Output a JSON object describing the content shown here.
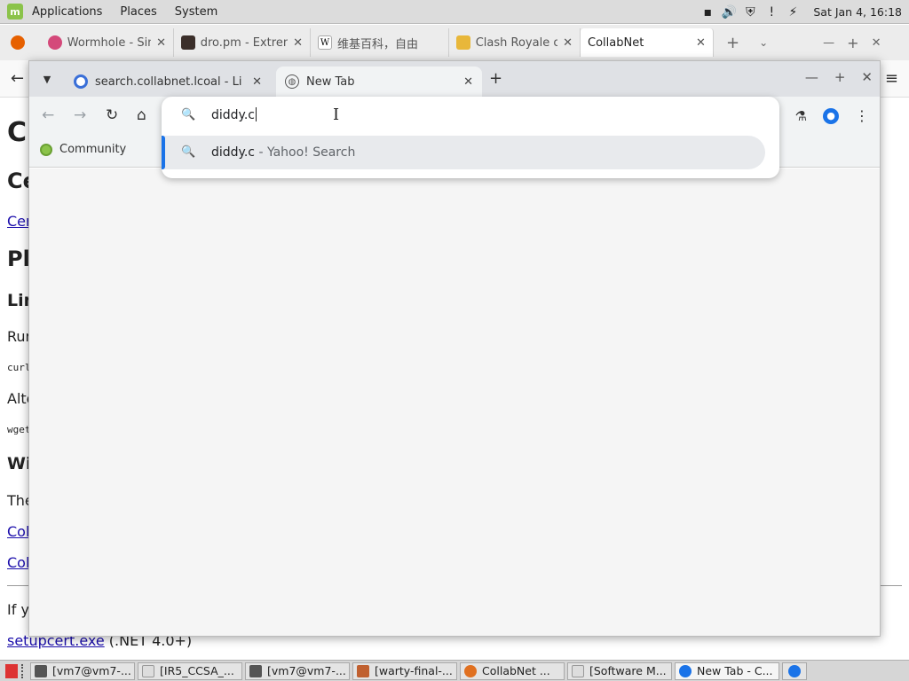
{
  "top_panel": {
    "menus": [
      "Applications",
      "Places",
      "System"
    ],
    "clock": "Sat Jan  4, 16:18"
  },
  "firefox": {
    "tabs": [
      {
        "label": "Wormhole - Sim",
        "icon": "wormhole-icon"
      },
      {
        "label": "dro.pm - Extren",
        "icon": "dropm-icon"
      },
      {
        "label": "维基百科，自由",
        "icon": "wikipedia-icon"
      },
      {
        "label": "Clash Royale on",
        "icon": "clash-royale-icon"
      },
      {
        "label": "CollabNet",
        "icon": "collabnet-icon"
      }
    ]
  },
  "bg_page": {
    "h1": "C",
    "h2a": "Ce",
    "link1": "Cer",
    "h2b": "Pl",
    "h3a": "Lin",
    "p1": "Run",
    "code1": "curl",
    "p2": "Alte",
    "code2": "wget",
    "h3b": "Wi",
    "p3": "The",
    "link2": "Col",
    "link3": "Col",
    "p4": "If y",
    "footer_link": "setupcert.exe",
    "footer_text": " (.NET 4.0+)"
  },
  "chrome": {
    "tabs": [
      {
        "label": "search.collabnet.lcoal - Linu"
      },
      {
        "label": "New Tab"
      }
    ],
    "bookmark": "Community",
    "omnibox": {
      "text": "diddy.c",
      "suggestion_main": "diddy.c",
      "suggestion_sub": " - Yahoo! Search"
    }
  },
  "taskbar": {
    "items": [
      {
        "label": "[vm7@vm7-...",
        "color": "#555555"
      },
      {
        "label": "[IR5_CCSA_...",
        "color": "#dddddd"
      },
      {
        "label": "[vm7@vm7-...",
        "color": "#555555"
      },
      {
        "label": "[warty-final-...",
        "color": "#c06030"
      },
      {
        "label": "CollabNet ...",
        "color": "#e07020"
      },
      {
        "label": "[Software M...",
        "color": "#dddddd"
      },
      {
        "label": "New Tab - C...",
        "color": "#1a73e8"
      }
    ]
  },
  "colors": {
    "accent": "#1a73e8",
    "mint": "#8bc34a",
    "link": "#1a0dab"
  }
}
